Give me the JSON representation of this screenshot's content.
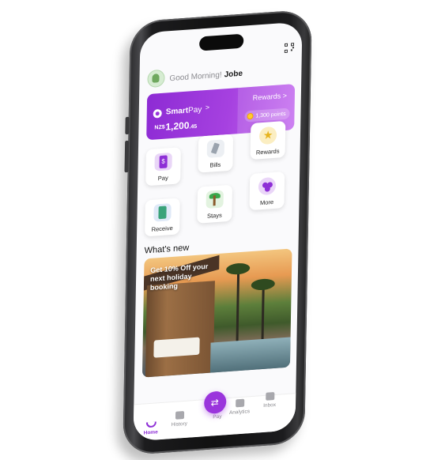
{
  "header": {
    "greeting": "Good Morning!",
    "user_name": "Jobe",
    "qr_icon": "qr-code-icon"
  },
  "smartpay_card": {
    "brand_bold": "Smart",
    "brand_rest": "Pay",
    "chevron": ">",
    "currency": "NZ$",
    "balance_main": "1,200",
    "balance_cents": ".45",
    "rewards_label": "Rewards >",
    "points": "1,300 points"
  },
  "actions": [
    {
      "label": "Pay",
      "icon": "wallet-phone-icon"
    },
    {
      "label": "Bills",
      "icon": "bills-icon"
    },
    {
      "label": "Rewards",
      "icon": "star-icon"
    },
    {
      "label": "Receive",
      "icon": "receive-phone-icon"
    },
    {
      "label": "Stays",
      "icon": "palm-tree-icon"
    },
    {
      "label": "More",
      "icon": "more-dots-icon"
    }
  ],
  "whats_new": {
    "title": "What's new",
    "promo_text": "Get 10% Off your next holiday booking"
  },
  "tabbar": {
    "home": "Home",
    "history": "History",
    "pay": "Pay",
    "analytics": "Analytics",
    "inbox": "Inbox"
  },
  "colors": {
    "accent": "#9a35dc",
    "card_gradient_start": "#8d2bd4",
    "card_gradient_end": "#c56df0"
  }
}
